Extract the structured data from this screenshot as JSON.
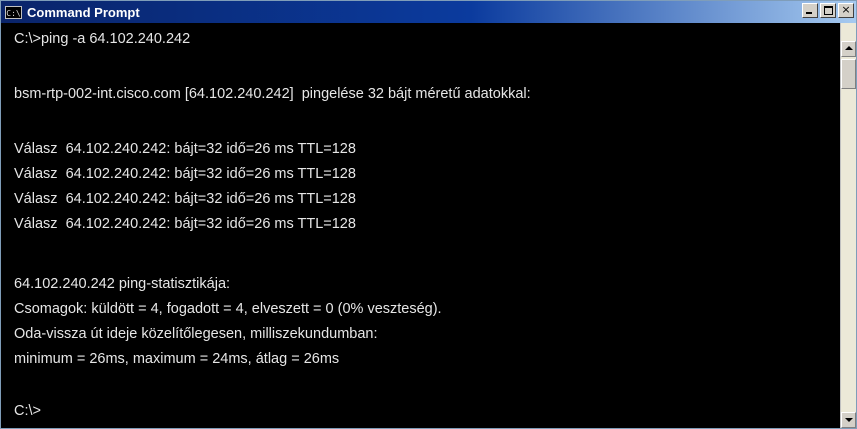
{
  "window": {
    "title": "Command Prompt",
    "icon": "cmd-icon",
    "icon_label": "C:\\",
    "controls": [
      "minimize-icon",
      "maximize-icon",
      "close-icon"
    ],
    "close_glyph": "×"
  },
  "console": {
    "lines": [
      "C:\\>ping -a 64.102.240.242",
      "",
      "bsm-rtp-002-int.cisco.com [64.102.240.242]  pingelése 32 bájt méretű adatokkal:",
      "",
      "Válasz  64.102.240.242: bájt=32 idő=26 ms TTL=128",
      "Válasz  64.102.240.242: bájt=32 idő=26 ms TTL=128",
      "Válasz  64.102.240.242: bájt=32 idő=26 ms TTL=128",
      "Válasz  64.102.240.242: bájt=32 idő=26 ms TTL=128",
      "",
      "64.102.240.242 ping-statisztikája:",
      "Csomagok: küldött = 4, fogadott = 4, elveszett = 0 (0% veszteség).",
      "Oda-vissza út ideje közelítőlegesen, milliszekundumban:",
      "minimum = 26ms, maximum = 24ms, átlag = 26ms",
      "",
      "C:\\>"
    ]
  },
  "colors": {
    "background": "#000000",
    "text": "#e6e6e6",
    "titlebar": "#0a246a"
  }
}
